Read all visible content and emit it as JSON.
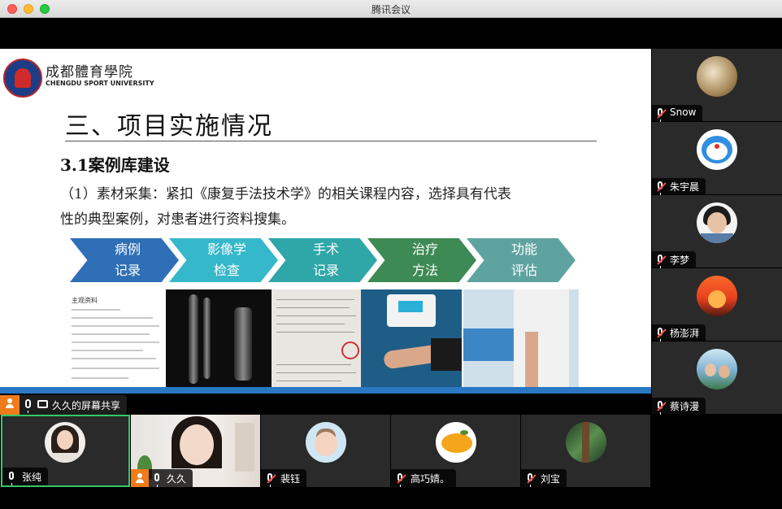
{
  "window": {
    "title": "腾讯会议"
  },
  "slide": {
    "university_cn": "成都體育學院",
    "university_en": "CHENGDU SPORT UNIVERSITY",
    "title": "三、项目实施情况",
    "section": "3.1案例库建设",
    "body_line1": "（1）素材采集：紧扣《康复手法技术学》的相关课程内容，选择具有代表",
    "body_line2": "性的典型案例，对患者进行资料搜集。",
    "flow": [
      {
        "line1": "病例",
        "line2": "记录",
        "color": "#2f6fb6"
      },
      {
        "line1": "影像学",
        "line2": "检查",
        "color": "#35b8c9"
      },
      {
        "line1": "手术",
        "line2": "记录",
        "color": "#2fa6a8"
      },
      {
        "line1": "治疗",
        "line2": "方法",
        "color": "#3e8a54"
      },
      {
        "line1": "功能",
        "line2": "评估",
        "color": "#5fa3a0"
      }
    ],
    "doc_title": "主观资料"
  },
  "share": {
    "label": "久久的屏幕共享"
  },
  "participants_side": [
    {
      "name": "Snow"
    },
    {
      "name": "朱宇晨"
    },
    {
      "name": "李梦"
    },
    {
      "name": "杨澎湃"
    },
    {
      "name": "蔡诗漫"
    }
  ],
  "participants_bottom": [
    {
      "name": "张纯"
    },
    {
      "name": "久久"
    },
    {
      "name": "裴钰"
    },
    {
      "name": "高巧婧。"
    },
    {
      "name": "刘宝"
    }
  ]
}
